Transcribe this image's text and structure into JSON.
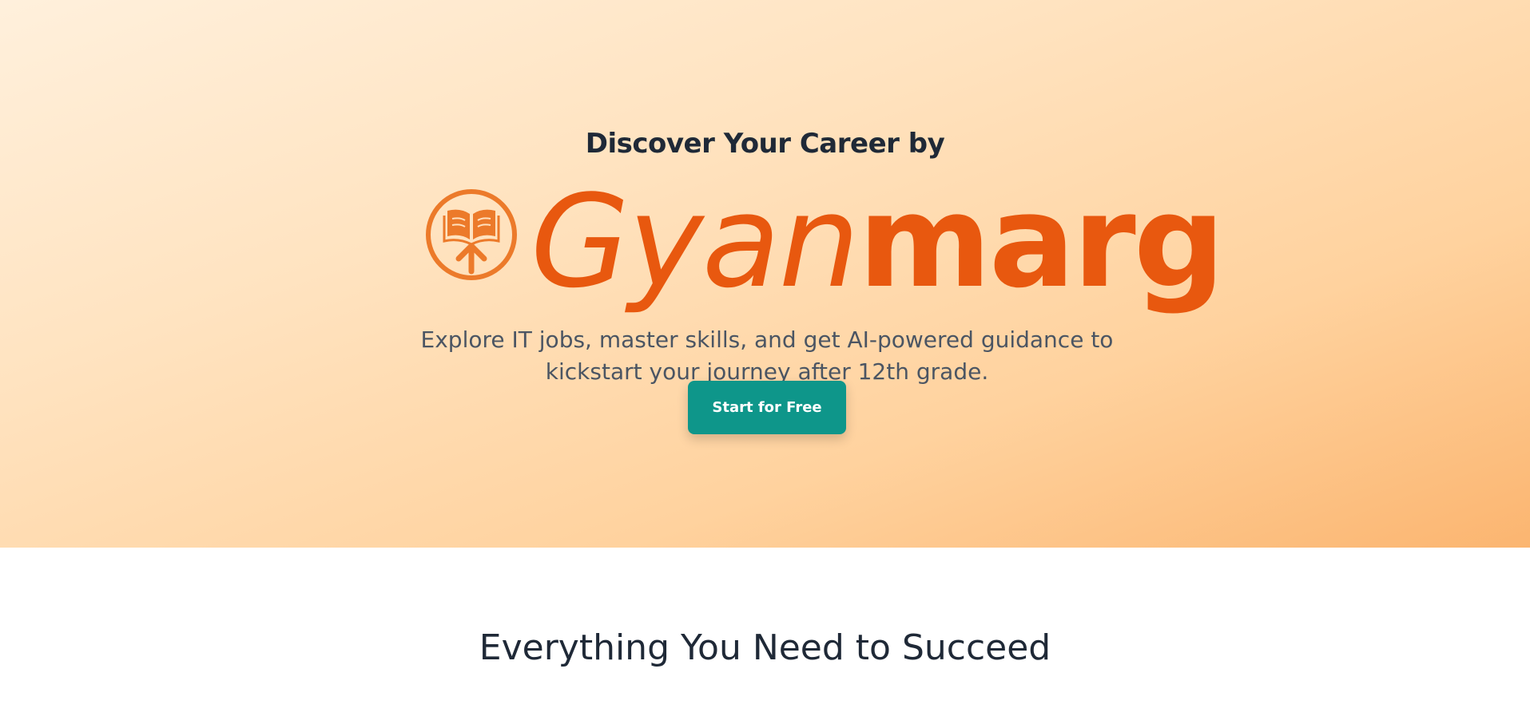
{
  "hero": {
    "eyebrow": "Discover Your Career by",
    "brand": {
      "part1": "Gyan",
      "part2": "marg",
      "logo_icon": "book-upload-icon"
    },
    "subtitle": "Explore IT jobs, master skills, and get AI-powered guidance to kickstart your journey after 12th grade.",
    "cta_label": "Start for Free"
  },
  "features": {
    "title": "Everything You Need to Succeed"
  },
  "colors": {
    "brand_orange": "#e8580f",
    "cta_teal": "#0e968a",
    "text_dark": "#1f2937",
    "text_muted": "#4b5563"
  }
}
